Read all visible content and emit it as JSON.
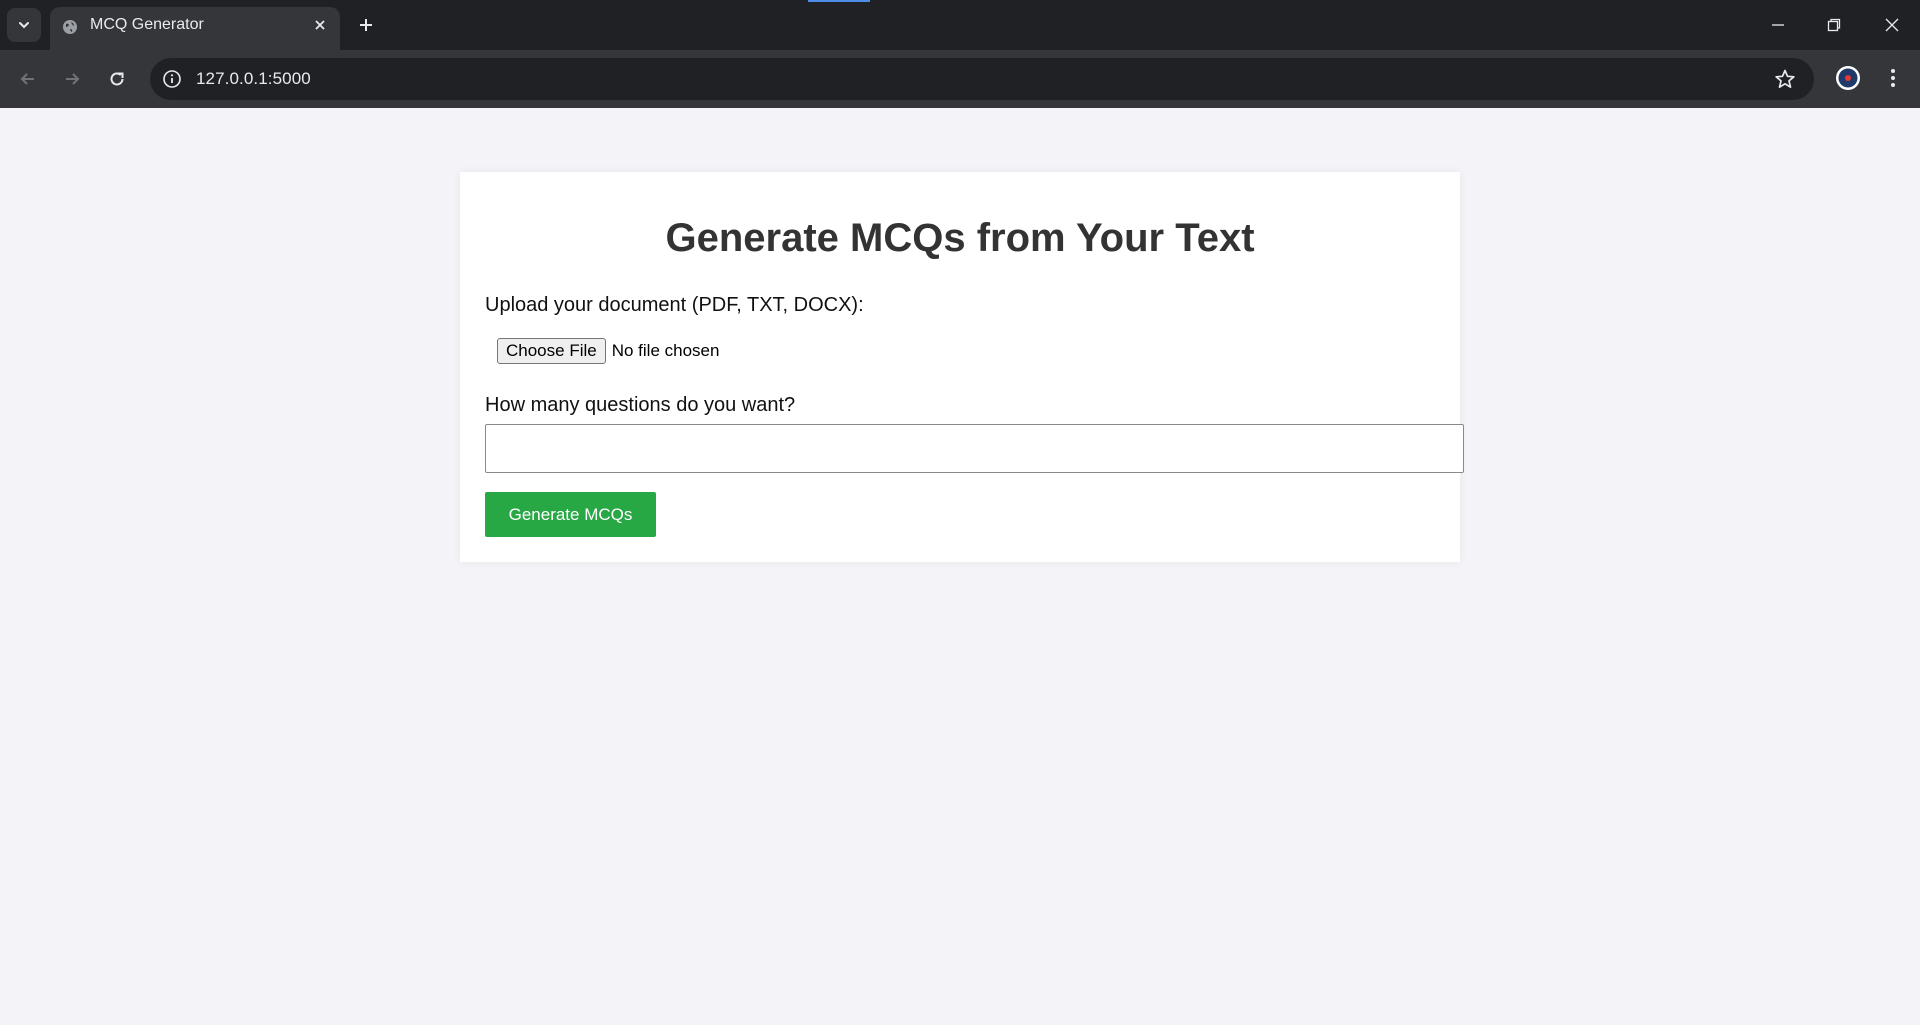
{
  "browser": {
    "tab_title": "MCQ Generator",
    "url": "127.0.0.1:5000",
    "icons": {
      "tab_search": "chevron-down-icon",
      "tab_favicon": "globe-icon",
      "tab_close": "close-icon",
      "new_tab": "plus-icon",
      "back": "arrow-left-icon",
      "forward": "arrow-right-icon",
      "reload": "reload-icon",
      "site_info": "info-icon",
      "bookmark": "star-icon",
      "profile": "profile-icon",
      "menu": "kebab-menu-icon",
      "minimize": "minimize-icon",
      "restore": "restore-icon",
      "close_window": "close-icon"
    },
    "colors": {
      "titlebar": "#202124",
      "toolbar": "#35363a"
    }
  },
  "page": {
    "heading": "Generate MCQs from Your Text",
    "upload_label": "Upload your document (PDF, TXT, DOCX):",
    "file_button": "Choose File",
    "file_status": "No file chosen",
    "questions_label": "How many questions do you want?",
    "questions_value": "",
    "submit_button": "Generate MCQs",
    "colors": {
      "background": "#f4f4f8",
      "card": "#ffffff",
      "submit": "#28a745"
    }
  }
}
